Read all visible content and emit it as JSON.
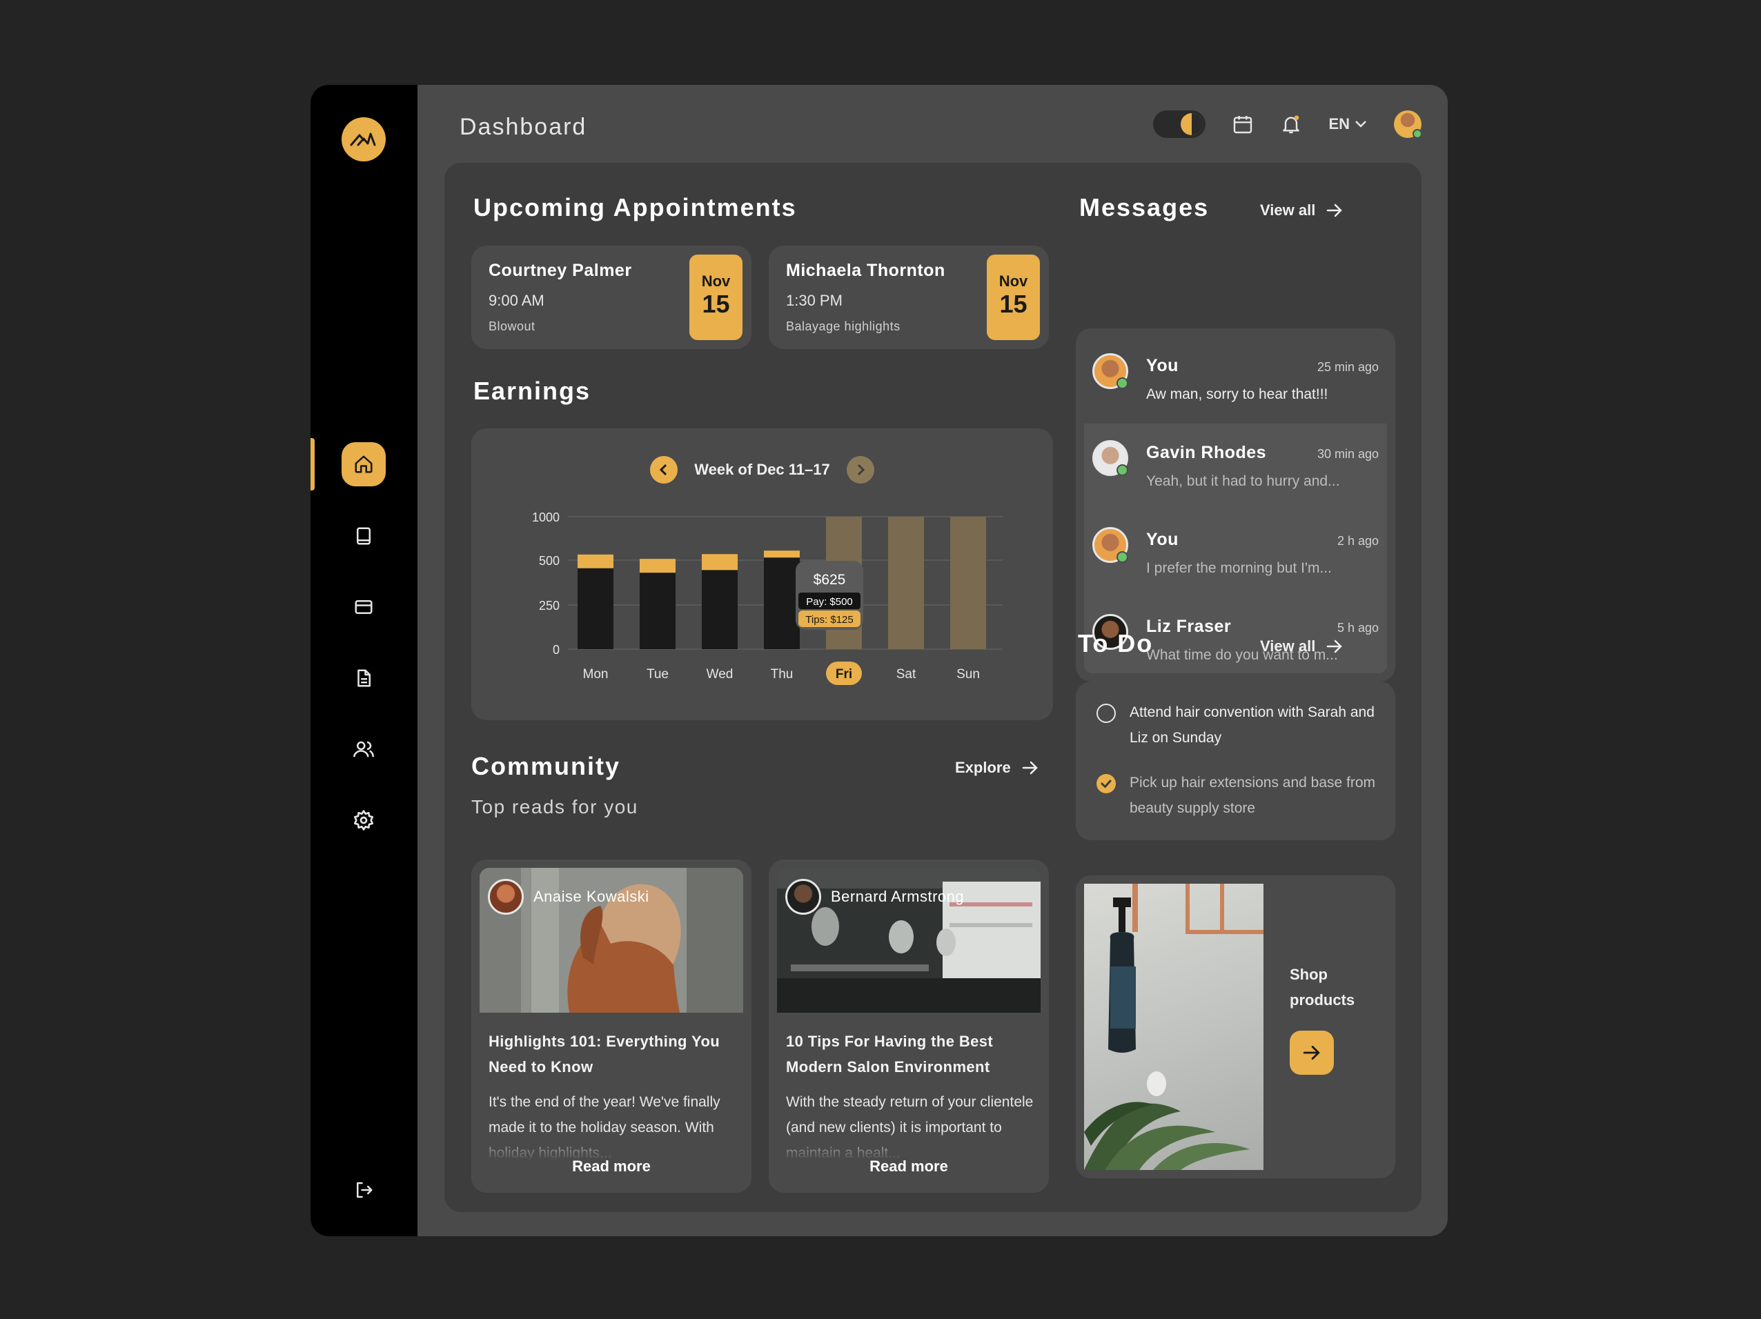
{
  "header": {
    "title": "Dashboard",
    "lang": "EN"
  },
  "appointments": {
    "title": "Upcoming Appointments",
    "items": [
      {
        "name": "Courtney Palmer",
        "time": "9:00 AM",
        "service": "Blowout",
        "month": "Nov",
        "day": "15"
      },
      {
        "name": "Michaela Thornton",
        "time": "1:30 PM",
        "service": "Balayage highlights",
        "month": "Nov",
        "day": "15"
      }
    ]
  },
  "earnings": {
    "title": "Earnings",
    "week_label": "Week of Dec 11–17",
    "tooltip": {
      "total": "$625",
      "pay": "Pay: $500",
      "tips": "Tips: $125"
    }
  },
  "chart_data": {
    "type": "bar",
    "stacked": true,
    "categories": [
      "Mon",
      "Tue",
      "Wed",
      "Thu",
      "Fri",
      "Sat",
      "Sun"
    ],
    "series": [
      {
        "name": "Pay",
        "values": [
          455,
          430,
          445,
          530,
          null,
          null,
          null
        ]
      },
      {
        "name": "Tips",
        "values": [
          110,
          85,
          125,
          80,
          null,
          null,
          null
        ]
      }
    ],
    "y_ticks": [
      0,
      250,
      500,
      1000
    ],
    "ylim": [
      0,
      1000
    ],
    "highlighted_category": "Fri",
    "future_categories": [
      "Fri",
      "Sat",
      "Sun"
    ],
    "colors": {
      "pay": "#1a1a1a",
      "tips": "#e9b04b",
      "future": "#7a6a4f"
    }
  },
  "messages": {
    "title": "Messages",
    "view_all": "View all",
    "items": [
      {
        "name": "You",
        "time": "25 min ago",
        "text": "Aw man, sorry to hear that!!!"
      },
      {
        "name": "Gavin Rhodes",
        "time": "30 min ago",
        "text": "Yeah, but it had to hurry and..."
      },
      {
        "name": "You",
        "time": "2 h ago",
        "text": "I prefer the morning but I'm..."
      },
      {
        "name": "Liz Fraser",
        "time": "5 h ago",
        "text": "What time do you want to m..."
      }
    ]
  },
  "todo": {
    "title": "To Do",
    "view_all": "View all",
    "items": [
      {
        "text": "Attend hair convention with Sarah and Liz on Sunday",
        "done": false
      },
      {
        "text": "Pick up hair extensions and base from beauty supply store",
        "done": true
      }
    ]
  },
  "shop": {
    "title": "Shop products"
  },
  "community": {
    "title": "Community",
    "explore": "Explore",
    "subtitle": "Top reads for you",
    "articles": [
      {
        "author": "Anaise Kowalski",
        "title": "Highlights 101: Everything You Need to Know",
        "body": "It's the end of the year! We've finally made it to the holiday season. With holiday highlights...",
        "read_more": "Read more"
      },
      {
        "author": "Bernard Armstrong",
        "title": "10 Tips For Having the Best Modern Salon Environment",
        "body": "With the steady return of your clientele (and new clients) it is important to maintain a healt...",
        "read_more": "Read more"
      }
    ]
  },
  "icons": {
    "sidebar": [
      "home-icon",
      "book-icon",
      "card-icon",
      "document-icon",
      "users-icon",
      "gear-icon"
    ],
    "logout": "logout-icon"
  },
  "colors": {
    "accent": "#e9b04b",
    "sidebar": "#000000",
    "panel": "#3d3d3d",
    "card": "#4a4a4a"
  }
}
